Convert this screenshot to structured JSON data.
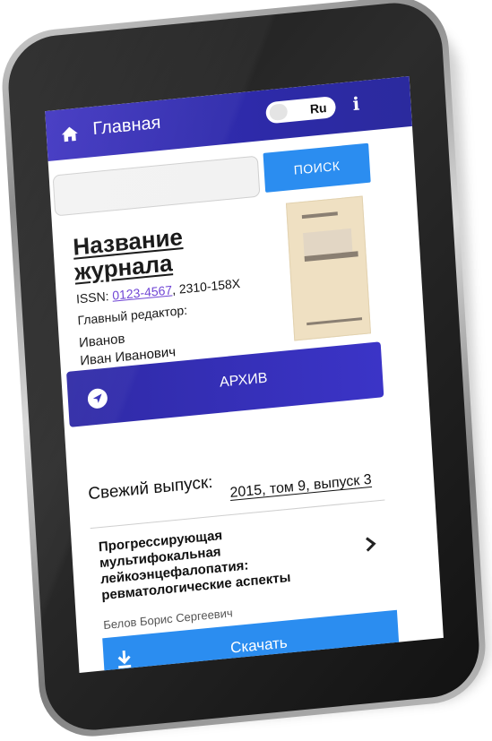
{
  "header": {
    "home_title": "Главная",
    "lang_label": "Ru",
    "info_label": "i"
  },
  "search": {
    "placeholder": "",
    "value": "",
    "button_label": "ПОИСК"
  },
  "journal": {
    "title_line1": "Название",
    "title_line2": "журнала",
    "issn_prefix": "ISSN: ",
    "issn_link": "0123-4567",
    "issn_rest": ", 2310-158X",
    "editor_label": "Главный редактор:",
    "editor_name_line1": "Иванов",
    "editor_name_line2": "Иван Иванович"
  },
  "archive": {
    "label": "АРХИВ"
  },
  "fresh_issue": {
    "label": "Свежий выпуск:",
    "value": "2015, том 9, выпуск 3"
  },
  "article": {
    "title_line1": "Прогрессирующая",
    "title_line2": "мультифокальная",
    "title_line3": "лейкоэнцефалопатия:",
    "title_line4": "ревматологические аспекты",
    "author": "Белов Борис Сергеевич"
  },
  "download": {
    "label": "Скачать"
  },
  "colors": {
    "header": "#2d2aa8",
    "accent": "#2b8df0",
    "archive": "#3530b8",
    "link": "#6b3fd4"
  },
  "icons": {
    "home": "home-icon",
    "info": "info-icon",
    "archive": "navigation-arrow-icon",
    "chevron": "chevron-right-icon",
    "download": "download-icon"
  }
}
